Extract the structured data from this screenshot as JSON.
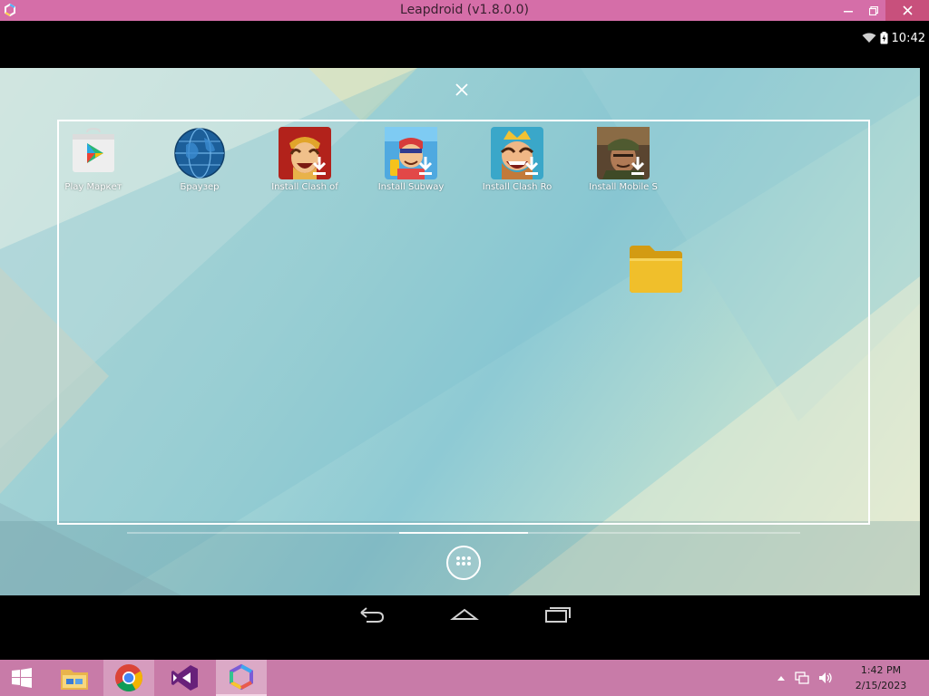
{
  "window": {
    "title": "Leapdroid (v1.8.0.0)",
    "icons": [
      "leapdroid-app-icon",
      "minimize-icon",
      "maximize-icon",
      "close-icon"
    ]
  },
  "android": {
    "status_time": "10:42",
    "status_icons": [
      "wifi-icon",
      "battery-charging-icon"
    ],
    "home_apps": [
      {
        "label": "Play Маркет",
        "icon": "play-store-icon"
      },
      {
        "label": "Браузер",
        "icon": "browser-globe-icon"
      },
      {
        "label": "Install Clash of",
        "icon": "clash-of-clans-icon"
      },
      {
        "label": "Install Subway",
        "icon": "subway-surfers-icon"
      },
      {
        "label": "Install Clash Ro",
        "icon": "clash-royale-icon"
      },
      {
        "label": "Install Mobile S",
        "icon": "mobile-strike-icon"
      }
    ],
    "folder_icon": "folder-icon",
    "nav": [
      "back-icon",
      "home-icon",
      "recent-apps-icon"
    ]
  },
  "taskbar": {
    "items": [
      "windows-start-icon",
      "file-explorer-icon",
      "chrome-icon",
      "visual-studio-icon",
      "leapdroid-icon"
    ],
    "clock_time": "1:42 PM",
    "clock_date": "2/15/2023"
  },
  "colors": {
    "titlebar": "#d56ea8",
    "taskbar": "#c87ba8",
    "wallpaper_primary": "#8ecad4"
  }
}
